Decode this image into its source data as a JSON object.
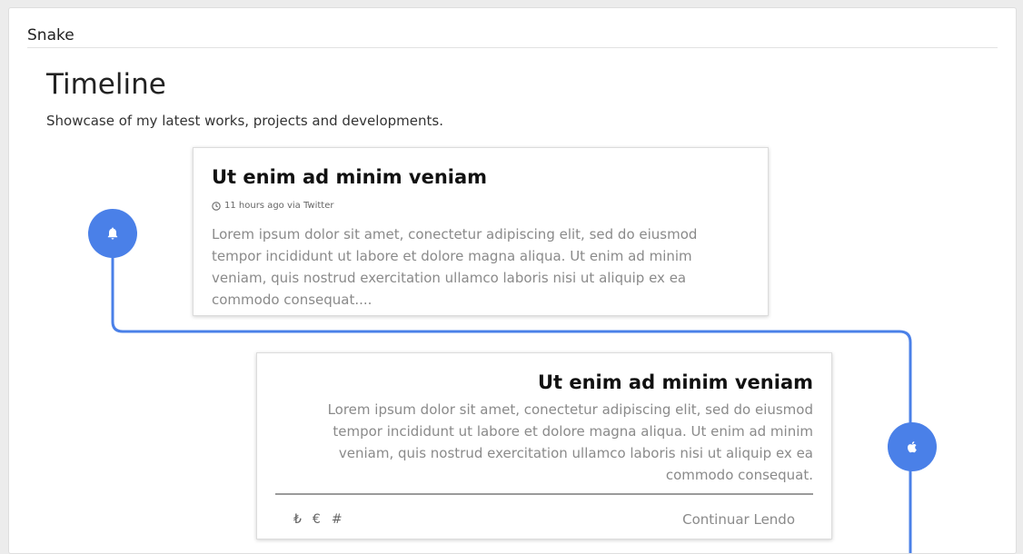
{
  "panel": {
    "title": "Snake"
  },
  "page": {
    "title": "Timeline",
    "subtitle": "Showcase of my latest works, projects and developments."
  },
  "colors": {
    "accent": "#4a80e8",
    "muted_text": "#8a8a8a"
  },
  "timeline": [
    {
      "icon": "bell-icon",
      "title": "Ut enim ad minim veniam",
      "meta": "11 hours ago via Twitter",
      "meta_icon": "clock-icon",
      "body": "Lorem ipsum dolor sit amet, conectetur adipiscing elit, sed do eiusmod tempor incididunt ut labore et dolore magna aliqua. Ut enim ad minim veniam, quis nostrud exercitation ullamco laboris nisi ut aliquip ex ea commodo consequat...."
    },
    {
      "icon": "apple-icon",
      "title": "Ut enim ad minim veniam",
      "body": "Lorem ipsum dolor sit amet, conectetur adipiscing elit, sed do eiusmod tempor incididunt ut labore et dolore magna aliqua. Ut enim ad minim veniam, quis nostrud exercitation ullamco laboris nisi ut aliquip ex ea commodo consequat.",
      "footer_icons": [
        "₺",
        "€",
        "#"
      ],
      "footer_icon_names": [
        "lira-icon",
        "euro-icon",
        "hashtag-icon"
      ],
      "continue_label": "Continuar Lendo"
    }
  ]
}
